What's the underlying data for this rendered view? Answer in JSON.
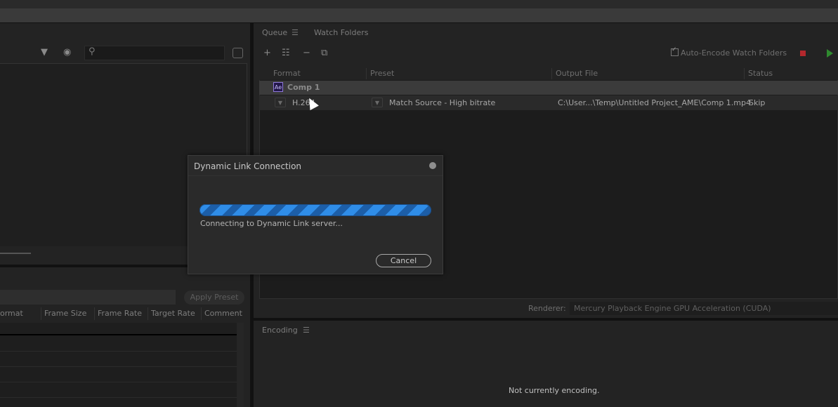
{
  "queue": {
    "tab_queue": "Queue",
    "tab_watch": "Watch Folders",
    "auto_encode_label": "Auto-Encode Watch Folders",
    "headers": [
      "Format",
      "Preset",
      "Output File",
      "Status"
    ],
    "group": {
      "badge": "Ae",
      "name": "Comp 1"
    },
    "item": {
      "format": "H.264",
      "preset": "Match Source - High bitrate",
      "output": "C:\\User...\\Temp\\Untitled Project_AME\\Comp 1.mp4",
      "status": "Skip"
    },
    "renderer_label": "Renderer:",
    "renderer_value": "Mercury Playback Engine GPU Acceleration (CUDA)"
  },
  "preset_browser": {
    "apply_label": "Apply Preset",
    "columns": [
      "ormat",
      "Frame Size",
      "Frame Rate",
      "Target Rate",
      "Comment"
    ]
  },
  "encoding": {
    "tab": "Encoding",
    "status": "Not currently encoding."
  },
  "dialog": {
    "title": "Dynamic Link Connection",
    "status": "Connecting to Dynamic Link server...",
    "cancel_label": "Cancel",
    "progress_color": "#2f8de8"
  },
  "colors": {
    "stop": "#b3282d",
    "play": "#2f8a2f",
    "ae_badge": "#8f7ad8"
  }
}
